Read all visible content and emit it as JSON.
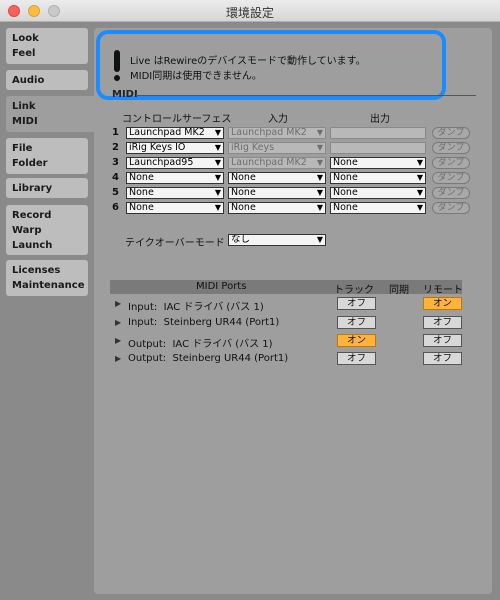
{
  "window": {
    "title": "環境設定"
  },
  "sidebar": {
    "tabs": [
      {
        "lines": [
          "Look",
          "Feel"
        ],
        "active": false
      },
      {
        "lines": [
          "Audio"
        ],
        "active": false
      },
      {
        "lines": [
          "Link",
          "MIDI"
        ],
        "active": true
      },
      {
        "lines": [
          "File",
          "Folder"
        ],
        "active": false
      },
      {
        "lines": [
          "Library"
        ],
        "active": false
      },
      {
        "lines": [
          "Record",
          "Warp",
          "Launch"
        ],
        "active": false
      },
      {
        "lines": [
          "Licenses",
          "Maintenance"
        ],
        "active": false
      }
    ]
  },
  "notice": {
    "line1": "Live はRewireのデバイスモードで動作しています。",
    "line2": "MIDI同期は使用できません。"
  },
  "midi": {
    "section_label": "MIDI",
    "columns": {
      "control_surface": "コントロールサーフェス",
      "input": "入力",
      "output": "出力"
    },
    "rows": [
      {
        "num": "1",
        "surface": "Launchpad MK2",
        "input": "Launchpad MK2",
        "input_disabled": true,
        "output": "",
        "output_disabled": true,
        "dump": "ダンプ"
      },
      {
        "num": "2",
        "surface": "iRig Keys IO",
        "input": "iRig Keys",
        "input_disabled": true,
        "output": "",
        "output_disabled": true,
        "dump": "ダンプ"
      },
      {
        "num": "3",
        "surface": "Launchpad95",
        "input": "Launchpad MK2",
        "input_disabled": true,
        "output": "None",
        "output_disabled": false,
        "dump": "ダンプ"
      },
      {
        "num": "4",
        "surface": "None",
        "input": "None",
        "input_disabled": false,
        "output": "None",
        "output_disabled": false,
        "dump": "ダンプ"
      },
      {
        "num": "5",
        "surface": "None",
        "input": "None",
        "input_disabled": false,
        "output": "None",
        "output_disabled": false,
        "dump": "ダンプ"
      },
      {
        "num": "6",
        "surface": "None",
        "input": "None",
        "input_disabled": false,
        "output": "None",
        "output_disabled": false,
        "dump": "ダンプ"
      }
    ],
    "takeover_label": "テイクオーバーモード",
    "takeover_value": "なし"
  },
  "ports": {
    "header": {
      "title": "MIDI Ports",
      "track": "トラック",
      "sync": "同期",
      "remote": "リモート"
    },
    "rows": [
      {
        "direction": "Input:",
        "name": "IAC ドライバ (バス 1)",
        "track": "オフ",
        "track_on": false,
        "remote": "オン",
        "remote_on": true
      },
      {
        "direction": "Input:",
        "name": "Steinberg UR44 (Port1)",
        "track": "オフ",
        "track_on": false,
        "remote": "オフ",
        "remote_on": false
      },
      {
        "direction": "Output:",
        "name": "IAC ドライバ (バス 1)",
        "track": "オン",
        "track_on": true,
        "remote": "オフ",
        "remote_on": false
      },
      {
        "direction": "Output:",
        "name": "Steinberg UR44 (Port1)",
        "track": "オフ",
        "track_on": false,
        "remote": "オフ",
        "remote_on": false
      }
    ]
  },
  "colors": {
    "accent_highlight": "#1a8cff",
    "on_button": "#ffb23c"
  }
}
